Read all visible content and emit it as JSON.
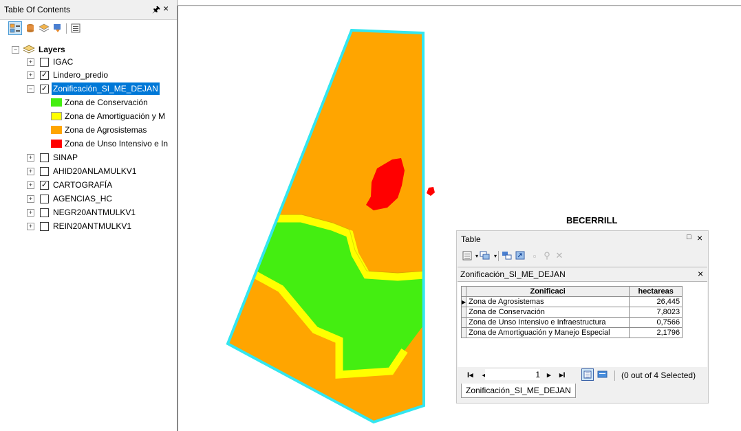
{
  "toc": {
    "title": "Table Of Contents",
    "pin_icon": "pin-icon",
    "close_label": "×",
    "root_label": "Layers",
    "layers": [
      {
        "name": "IGAC",
        "checked": false,
        "expanded": false
      },
      {
        "name": "Lindero_predio",
        "checked": true,
        "expanded": false
      },
      {
        "name": "Zonificación_SI_ME_DEJAN",
        "checked": true,
        "expanded": true,
        "selected": true
      },
      {
        "name": "SINAP",
        "checked": false,
        "expanded": false
      },
      {
        "name": "AHID20ANLAMULKV1",
        "checked": false,
        "expanded": false
      },
      {
        "name": "CARTOGRAFÍA",
        "checked": true,
        "expanded": false
      },
      {
        "name": "AGENCIAS_HC",
        "checked": false,
        "expanded": false
      },
      {
        "name": "NEGR20ANTMULKV1",
        "checked": false,
        "expanded": false
      },
      {
        "name": "REIN20ANTMULKV1",
        "checked": false,
        "expanded": false
      }
    ],
    "legend": [
      {
        "label": "Zona de Conservación",
        "color": "#44ee11"
      },
      {
        "label": "Zona de Amortiguación y M",
        "color": "#ffff00"
      },
      {
        "label": "Zona de Agrosistemas",
        "color": "#ffa500"
      },
      {
        "label": "Zona de Unso Intensivo e In",
        "color": "#ff0000"
      }
    ]
  },
  "map": {
    "caption": "BECERRILL",
    "colors": {
      "outline": "#33e6f0",
      "agro": "#ffa500",
      "conservacion": "#44ee11",
      "amortiguacion": "#ffff00",
      "intensivo": "#ff0000"
    }
  },
  "table_window": {
    "title": "Table",
    "max_label": "□",
    "close_label": "×",
    "layer_name": "Zonificación_SI_ME_DEJAN",
    "columns": [
      "Zonificaci",
      "hectareas"
    ],
    "rows": [
      {
        "zone": "Zona de Agrosistemas",
        "ha": "26,445",
        "current": true
      },
      {
        "zone": "Zona de Conservación",
        "ha": "7,8023"
      },
      {
        "zone": "Zona de Unso Intensivo e Infraestructura",
        "ha": "0,7566"
      },
      {
        "zone": "Zona de Amortiguación y Manejo Especial",
        "ha": "2,1796"
      }
    ],
    "nav": {
      "first": "I◂",
      "prev": "◂",
      "page": "1",
      "next": "▸",
      "last": "▸I",
      "selection": "(0 out of 4 Selected)"
    },
    "tab_label": "Zonificación_SI_ME_DEJAN"
  }
}
